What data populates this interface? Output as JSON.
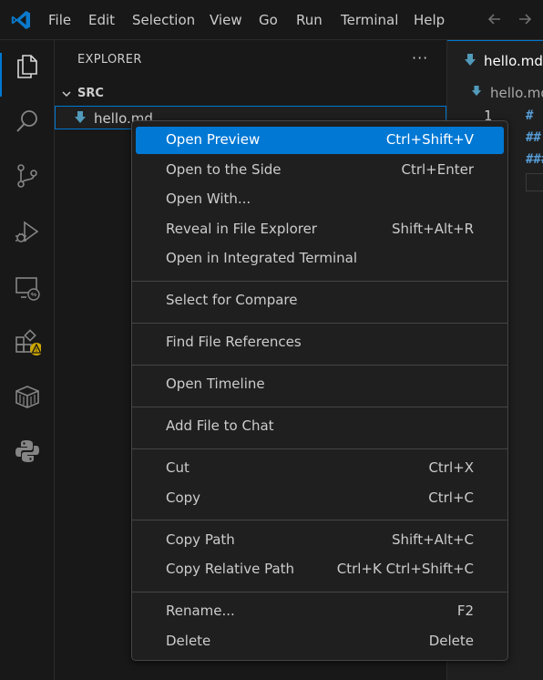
{
  "menubar": {
    "items": [
      "File",
      "Edit",
      "Selection",
      "View",
      "Go",
      "Run",
      "Terminal",
      "Help"
    ]
  },
  "activity_bar": {
    "icons": [
      "explorer-icon",
      "search-icon",
      "source-control-icon",
      "run-debug-icon",
      "remote-explorer-icon",
      "extensions-icon",
      "containers-icon",
      "python-icon"
    ],
    "warning_badge": "!"
  },
  "sidebar": {
    "title": "EXPLORER",
    "more_label": "···",
    "folder": "SRC",
    "file": "hello.md"
  },
  "editor": {
    "tab_label": "hello.md",
    "breadcrumb": "hello.md",
    "line_number": "1",
    "code_lines": [
      "# ",
      "##",
      "###"
    ]
  },
  "context_menu": {
    "groups": [
      [
        {
          "label": "Open Preview",
          "shortcut": "Ctrl+Shift+V"
        },
        {
          "label": "Open to the Side",
          "shortcut": "Ctrl+Enter"
        },
        {
          "label": "Open With...",
          "shortcut": ""
        },
        {
          "label": "Reveal in File Explorer",
          "shortcut": "Shift+Alt+R"
        },
        {
          "label": "Open in Integrated Terminal",
          "shortcut": ""
        }
      ],
      [
        {
          "label": "Select for Compare",
          "shortcut": ""
        }
      ],
      [
        {
          "label": "Find File References",
          "shortcut": ""
        }
      ],
      [
        {
          "label": "Open Timeline",
          "shortcut": ""
        }
      ],
      [
        {
          "label": "Add File to Chat",
          "shortcut": ""
        }
      ],
      [
        {
          "label": "Cut",
          "shortcut": "Ctrl+X"
        },
        {
          "label": "Copy",
          "shortcut": "Ctrl+C"
        }
      ],
      [
        {
          "label": "Copy Path",
          "shortcut": "Shift+Alt+C"
        },
        {
          "label": "Copy Relative Path",
          "shortcut": "Ctrl+K Ctrl+Shift+C"
        }
      ],
      [
        {
          "label": "Rename...",
          "shortcut": "F2"
        },
        {
          "label": "Delete",
          "shortcut": "Delete"
        }
      ]
    ],
    "highlighted_item": "Open Preview"
  },
  "colors": {
    "accent": "#0078d4",
    "markdown_icon": "#519aba",
    "warning_badge": "#cca700"
  }
}
